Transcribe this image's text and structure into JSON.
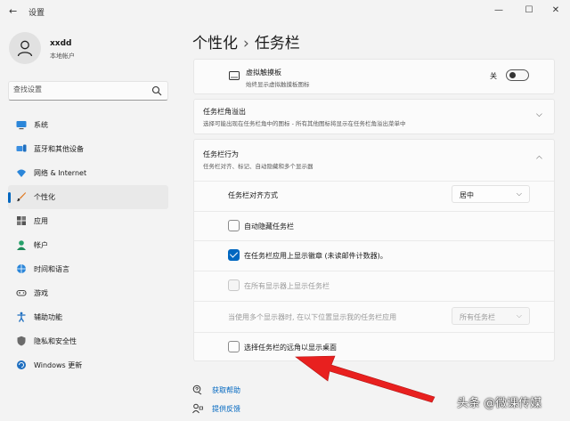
{
  "window": {
    "title": "设置",
    "back": "←",
    "minimize": "—",
    "maximize": "☐",
    "close": "✕"
  },
  "profile": {
    "name": "xxdd",
    "account": "本地帐户"
  },
  "search": {
    "placeholder": "查找设置"
  },
  "sidebar": {
    "items": [
      {
        "label": "系统",
        "icon": "system-icon"
      },
      {
        "label": "蓝牙和其他设备",
        "icon": "bluetooth-icon"
      },
      {
        "label": "网络 & Internet",
        "icon": "wifi-icon"
      },
      {
        "label": "个性化",
        "icon": "brush-icon",
        "active": true
      },
      {
        "label": "应用",
        "icon": "apps-icon"
      },
      {
        "label": "帐户",
        "icon": "account-icon"
      },
      {
        "label": "时间和语言",
        "icon": "globe-clock-icon"
      },
      {
        "label": "游戏",
        "icon": "gamepad-icon"
      },
      {
        "label": "辅助功能",
        "icon": "accessibility-icon"
      },
      {
        "label": "隐私和安全性",
        "icon": "shield-icon"
      },
      {
        "label": "Windows 更新",
        "icon": "update-icon"
      }
    ]
  },
  "breadcrumb": {
    "parent": "个性化",
    "separator": "›",
    "current": "任务栏"
  },
  "touchpad": {
    "title": "虚拟触摸板",
    "subtitle": "始终显示虚拟触摸板图标",
    "state": "关"
  },
  "overflow": {
    "title": "任务栏角溢出",
    "subtitle": "选择可能出现在任务栏角中的图标 - 所有其他图标将显示在任务栏角溢出菜单中"
  },
  "behaviors": {
    "title": "任务栏行为",
    "subtitle": "任务栏对齐、标记、自动隐藏和多个显示器",
    "alignment_label": "任务栏对齐方式",
    "alignment_value": "居中",
    "auto_hide": "自动隐藏任务栏",
    "show_badges": "在任务栏应用上显示徽章 (未读邮件计数器)。",
    "all_displays": "在所有显示器上显示任务栏",
    "multi_display_label": "当使用多个显示器时, 在以下位置显示我的任务栏应用",
    "multi_display_value": "所有任务栏",
    "far_corner": "选择任务栏的远角以显示桌面"
  },
  "footer": {
    "help": "获取帮助",
    "feedback": "提供反馈"
  },
  "watermark": "头条 @微课传媒",
  "colors": {
    "accent": "#0067c0",
    "arrow": "#e8201f"
  }
}
